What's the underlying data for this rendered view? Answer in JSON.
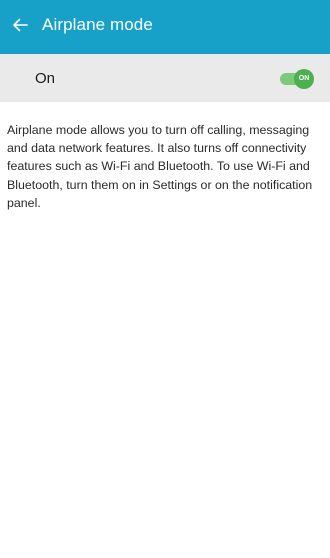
{
  "app_bar": {
    "back_icon": "back-arrow-icon",
    "title": "Airplane mode",
    "color": "#17a1c9"
  },
  "toggle": {
    "label": "On",
    "state_label": "ON",
    "checked": true,
    "accent": "#4caf50"
  },
  "description": "Airplane mode allows you to turn off calling, messaging and data network features. It also turns off connectivity features such as Wi-Fi and Bluetooth. To use Wi-Fi and Bluetooth, turn them on in Settings or on the notification panel."
}
